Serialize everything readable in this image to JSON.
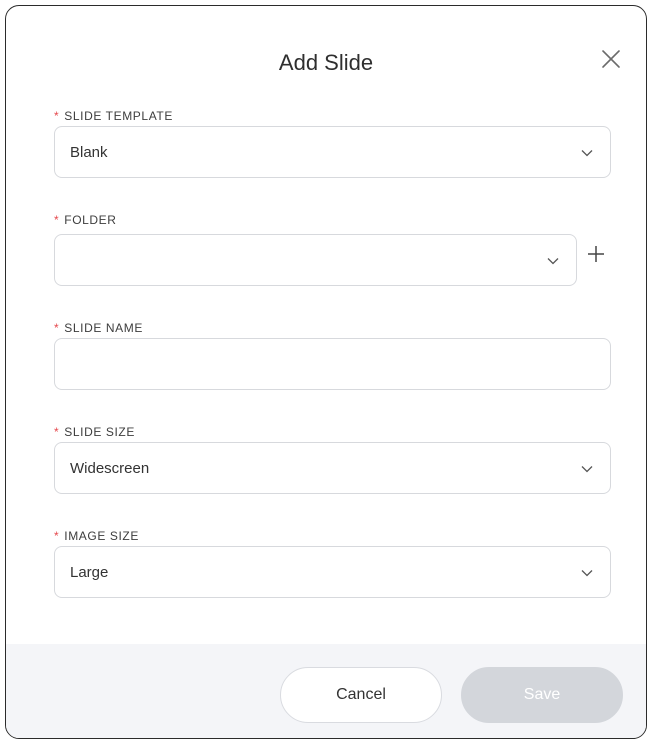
{
  "dialog": {
    "title": "Add Slide",
    "close_icon": "close-icon"
  },
  "fields": {
    "slide_template": {
      "required_mark": "*",
      "label": "SLIDE TEMPLATE",
      "value": "Blank",
      "icon": "chevron-down-icon"
    },
    "folder": {
      "required_mark": "*",
      "label": "FOLDER",
      "value": "",
      "icon": "chevron-down-icon",
      "add_icon": "plus-icon"
    },
    "slide_name": {
      "required_mark": "*",
      "label": "SLIDE NAME",
      "value": ""
    },
    "slide_size": {
      "required_mark": "*",
      "label": "SLIDE SIZE",
      "value": "Widescreen",
      "icon": "chevron-down-icon"
    },
    "image_size": {
      "required_mark": "*",
      "label": "IMAGE SIZE",
      "value": "Large",
      "icon": "chevron-down-icon"
    }
  },
  "footer": {
    "cancel_label": "Cancel",
    "save_label": "Save",
    "save_disabled": true
  },
  "colors": {
    "required": "#e5484d",
    "footer_bg": "#f4f5f8",
    "save_disabled_bg": "#d3d6db"
  }
}
